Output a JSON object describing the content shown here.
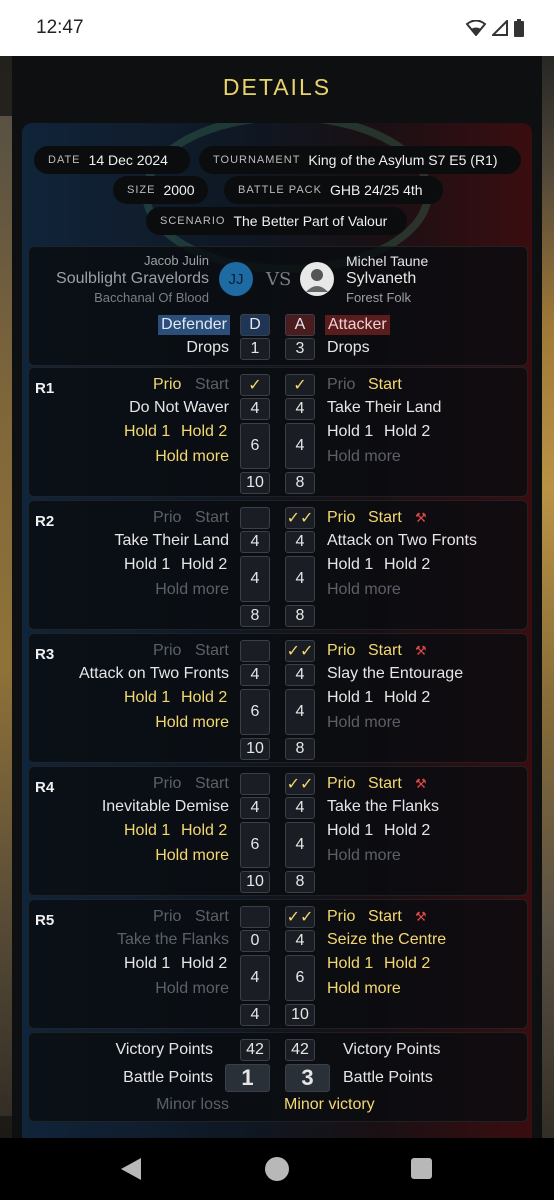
{
  "status_bar": {
    "time": "12:47",
    "icons": [
      "wifi-icon",
      "signal-icon",
      "battery-icon"
    ]
  },
  "page": {
    "title": "DETAILS"
  },
  "meta": {
    "date_label": "DATE",
    "date": "14 Dec 2024",
    "tournament_label": "TOURNAMENT",
    "tournament": "King of the Asylum S7 E5 (R1)",
    "size_label": "SIZE",
    "size": "2000",
    "battle_pack_label": "BATTLE PACK",
    "battle_pack": "GHB 24/25 4th",
    "scenario_label": "SCENARIO",
    "scenario": "The Better Part of Valour"
  },
  "players": {
    "left": {
      "name": "Jacob Julin",
      "army": "Soulblight Gravelords",
      "subfaction": "Bacchanal Of Blood",
      "initials": "JJ",
      "role": "Defender",
      "role_short": "D",
      "drops_label": "Drops",
      "drops": "1"
    },
    "vs": "VS",
    "right": {
      "name": "Michel Taune",
      "army": "Sylvaneth",
      "subfaction": "Forest Folk",
      "role": "Attacker",
      "role_short": "A",
      "drops_label": "Drops",
      "drops": "3"
    }
  },
  "labels": {
    "prio": "Prio",
    "start": "Start",
    "hold1": "Hold 1",
    "hold2": "Hold 2",
    "hold_more": "Hold more"
  },
  "rounds": [
    {
      "label": "R1",
      "left_tactic": "Do Not Waver",
      "left_tactic_score": "4",
      "left_hold_score": "6",
      "left_total": "10",
      "left_check": "✓",
      "right_tactic": "Take Their Land",
      "right_tactic_score": "4",
      "right_hold_score": "4",
      "right_total": "8",
      "right_check": "✓"
    },
    {
      "label": "R2",
      "left_tactic": "Take Their Land",
      "left_tactic_score": "4",
      "left_hold_score": "4",
      "left_total": "8",
      "left_check": "",
      "right_tactic": "Attack on Two Fronts",
      "right_tactic_score": "4",
      "right_hold_score": "4",
      "right_total": "8",
      "right_check": "✓✓"
    },
    {
      "label": "R3",
      "left_tactic": "Attack on Two Fronts",
      "left_tactic_score": "4",
      "left_hold_score": "6",
      "left_total": "10",
      "left_check": "",
      "right_tactic": "Slay the Entourage",
      "right_tactic_score": "4",
      "right_hold_score": "4",
      "right_total": "8",
      "right_check": "✓✓"
    },
    {
      "label": "R4",
      "left_tactic": "Inevitable Demise",
      "left_tactic_score": "4",
      "left_hold_score": "6",
      "left_total": "10",
      "left_check": "",
      "right_tactic": "Take the Flanks",
      "right_tactic_score": "4",
      "right_hold_score": "4",
      "right_total": "8",
      "right_check": "✓✓"
    },
    {
      "label": "R5",
      "left_tactic": "Take the Flanks",
      "left_tactic_score": "0",
      "left_hold_score": "4",
      "left_total": "4",
      "left_check": "",
      "right_tactic": "Seize the Centre",
      "right_tactic_score": "4",
      "right_hold_score": "6",
      "right_total": "10",
      "right_check": "✓✓"
    }
  ],
  "summary": {
    "vp_label": "Victory Points",
    "left_vp": "42",
    "right_vp": "42",
    "bp_label": "Battle Points",
    "left_bp": "1",
    "right_bp": "3",
    "left_result": "Minor loss",
    "right_result": "Minor victory"
  },
  "colors": {
    "accent": "#f3d870",
    "defender": "#2c4e7a",
    "attacker": "#5a1d1d",
    "avatar": "#1e6aa3"
  }
}
